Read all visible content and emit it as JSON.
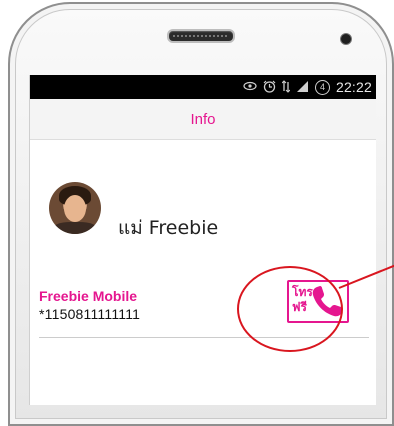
{
  "status_bar": {
    "time": "22:22",
    "notification_badge": "4",
    "icons": [
      "eye-icon",
      "alarm-icon",
      "data-arrows-icon",
      "signal-icon"
    ]
  },
  "header": {
    "title": "Info"
  },
  "contact": {
    "name": "แม่ Freebie",
    "avatar": "contact-photo"
  },
  "phone_entry": {
    "label": "Freebie Mobile",
    "number": "*1150811111111",
    "call_button": {
      "line1": "โทร",
      "line2": "ฟรี",
      "icon": "phone-handset-icon"
    }
  },
  "colors": {
    "accent": "#e5168f",
    "highlight": "#d9161f",
    "status_bar": "#000000"
  }
}
